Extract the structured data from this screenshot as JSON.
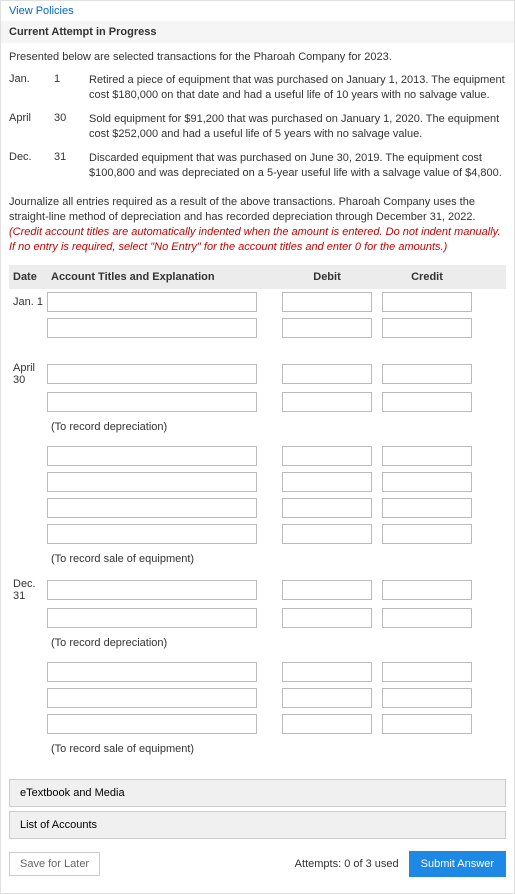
{
  "link_text": "View Policies",
  "status": "Current Attempt in Progress",
  "intro": "Presented below are selected transactions for the Pharoah Company for 2023.",
  "transactions": [
    {
      "month": "Jan.",
      "day": "1",
      "desc": "Retired a piece of equipment that was purchased on January 1, 2013. The equipment cost $180,000 on that date and had a useful life of 10 years with no salvage value."
    },
    {
      "month": "April",
      "day": "30",
      "desc": "Sold equipment for $91,200 that was purchased on January 1, 2020. The equipment cost $252,000 and had a useful life of 5 years with no salvage value."
    },
    {
      "month": "Dec.",
      "day": "31",
      "desc": "Discarded equipment that was purchased on June 30, 2019. The equipment cost $100,800 and was depreciated on a 5-year useful life with a salvage value of $4,800."
    }
  ],
  "journalize_black": "Journalize all entries required as a result of the above transactions. Pharoah Company uses the straight-line method of depreciation and has recorded depreciation through December 31, 2022. ",
  "journalize_red1": "(Credit account titles are automatically indented when the amount is entered. Do not indent manually. If no entry is required, select \"No Entry\" for the account titles and enter 0 for the amounts.)",
  "headers": {
    "date": "Date",
    "accounts": "Account Titles and Explanation",
    "debit": "Debit",
    "credit": "Credit"
  },
  "dates": {
    "jan1": "Jan. 1",
    "apr30": "April 30",
    "dec31": "Dec. 31"
  },
  "notes": {
    "depr": "(To record depreciation)",
    "sale": "(To record sale of equipment)"
  },
  "footer": {
    "etextbook": "eTextbook and Media",
    "list": "List of Accounts",
    "save": "Save for Later",
    "attempts": "Attempts: 0 of 3 used",
    "submit": "Submit Answer"
  }
}
